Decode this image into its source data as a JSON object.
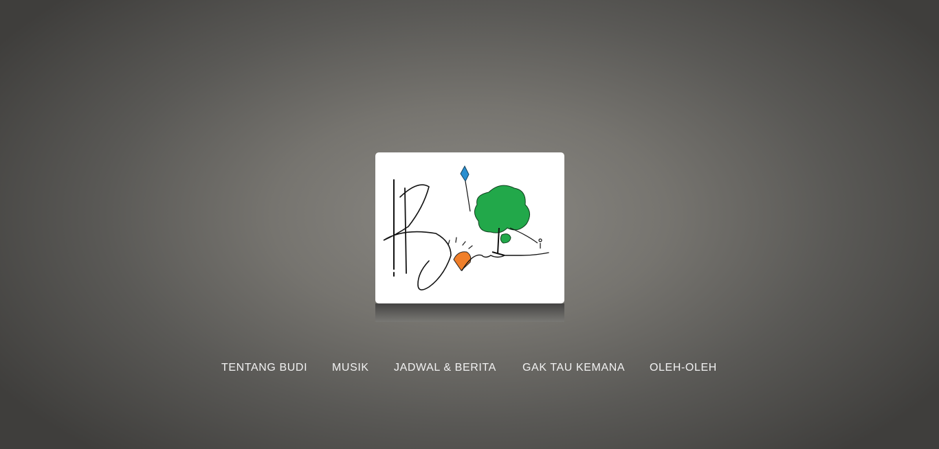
{
  "site": {
    "logo_icon": "hand-drawn-logo-icon",
    "logo_text": "B"
  },
  "nav": {
    "items": [
      {
        "label": "TENTANG BUDI"
      },
      {
        "label": "MUSIK"
      },
      {
        "label": "JADWAL & BERITA"
      },
      {
        "label": "GAK TAU KEMANA"
      },
      {
        "label": "OLEH-OLEH"
      }
    ]
  },
  "colors": {
    "nav_text": "#f2f2f2",
    "tree": "#22a84a",
    "sun": "#f07f2a",
    "kite": "#2a8fd0",
    "background_center": "#8b8984",
    "background_edge": "#3f3e3c"
  }
}
